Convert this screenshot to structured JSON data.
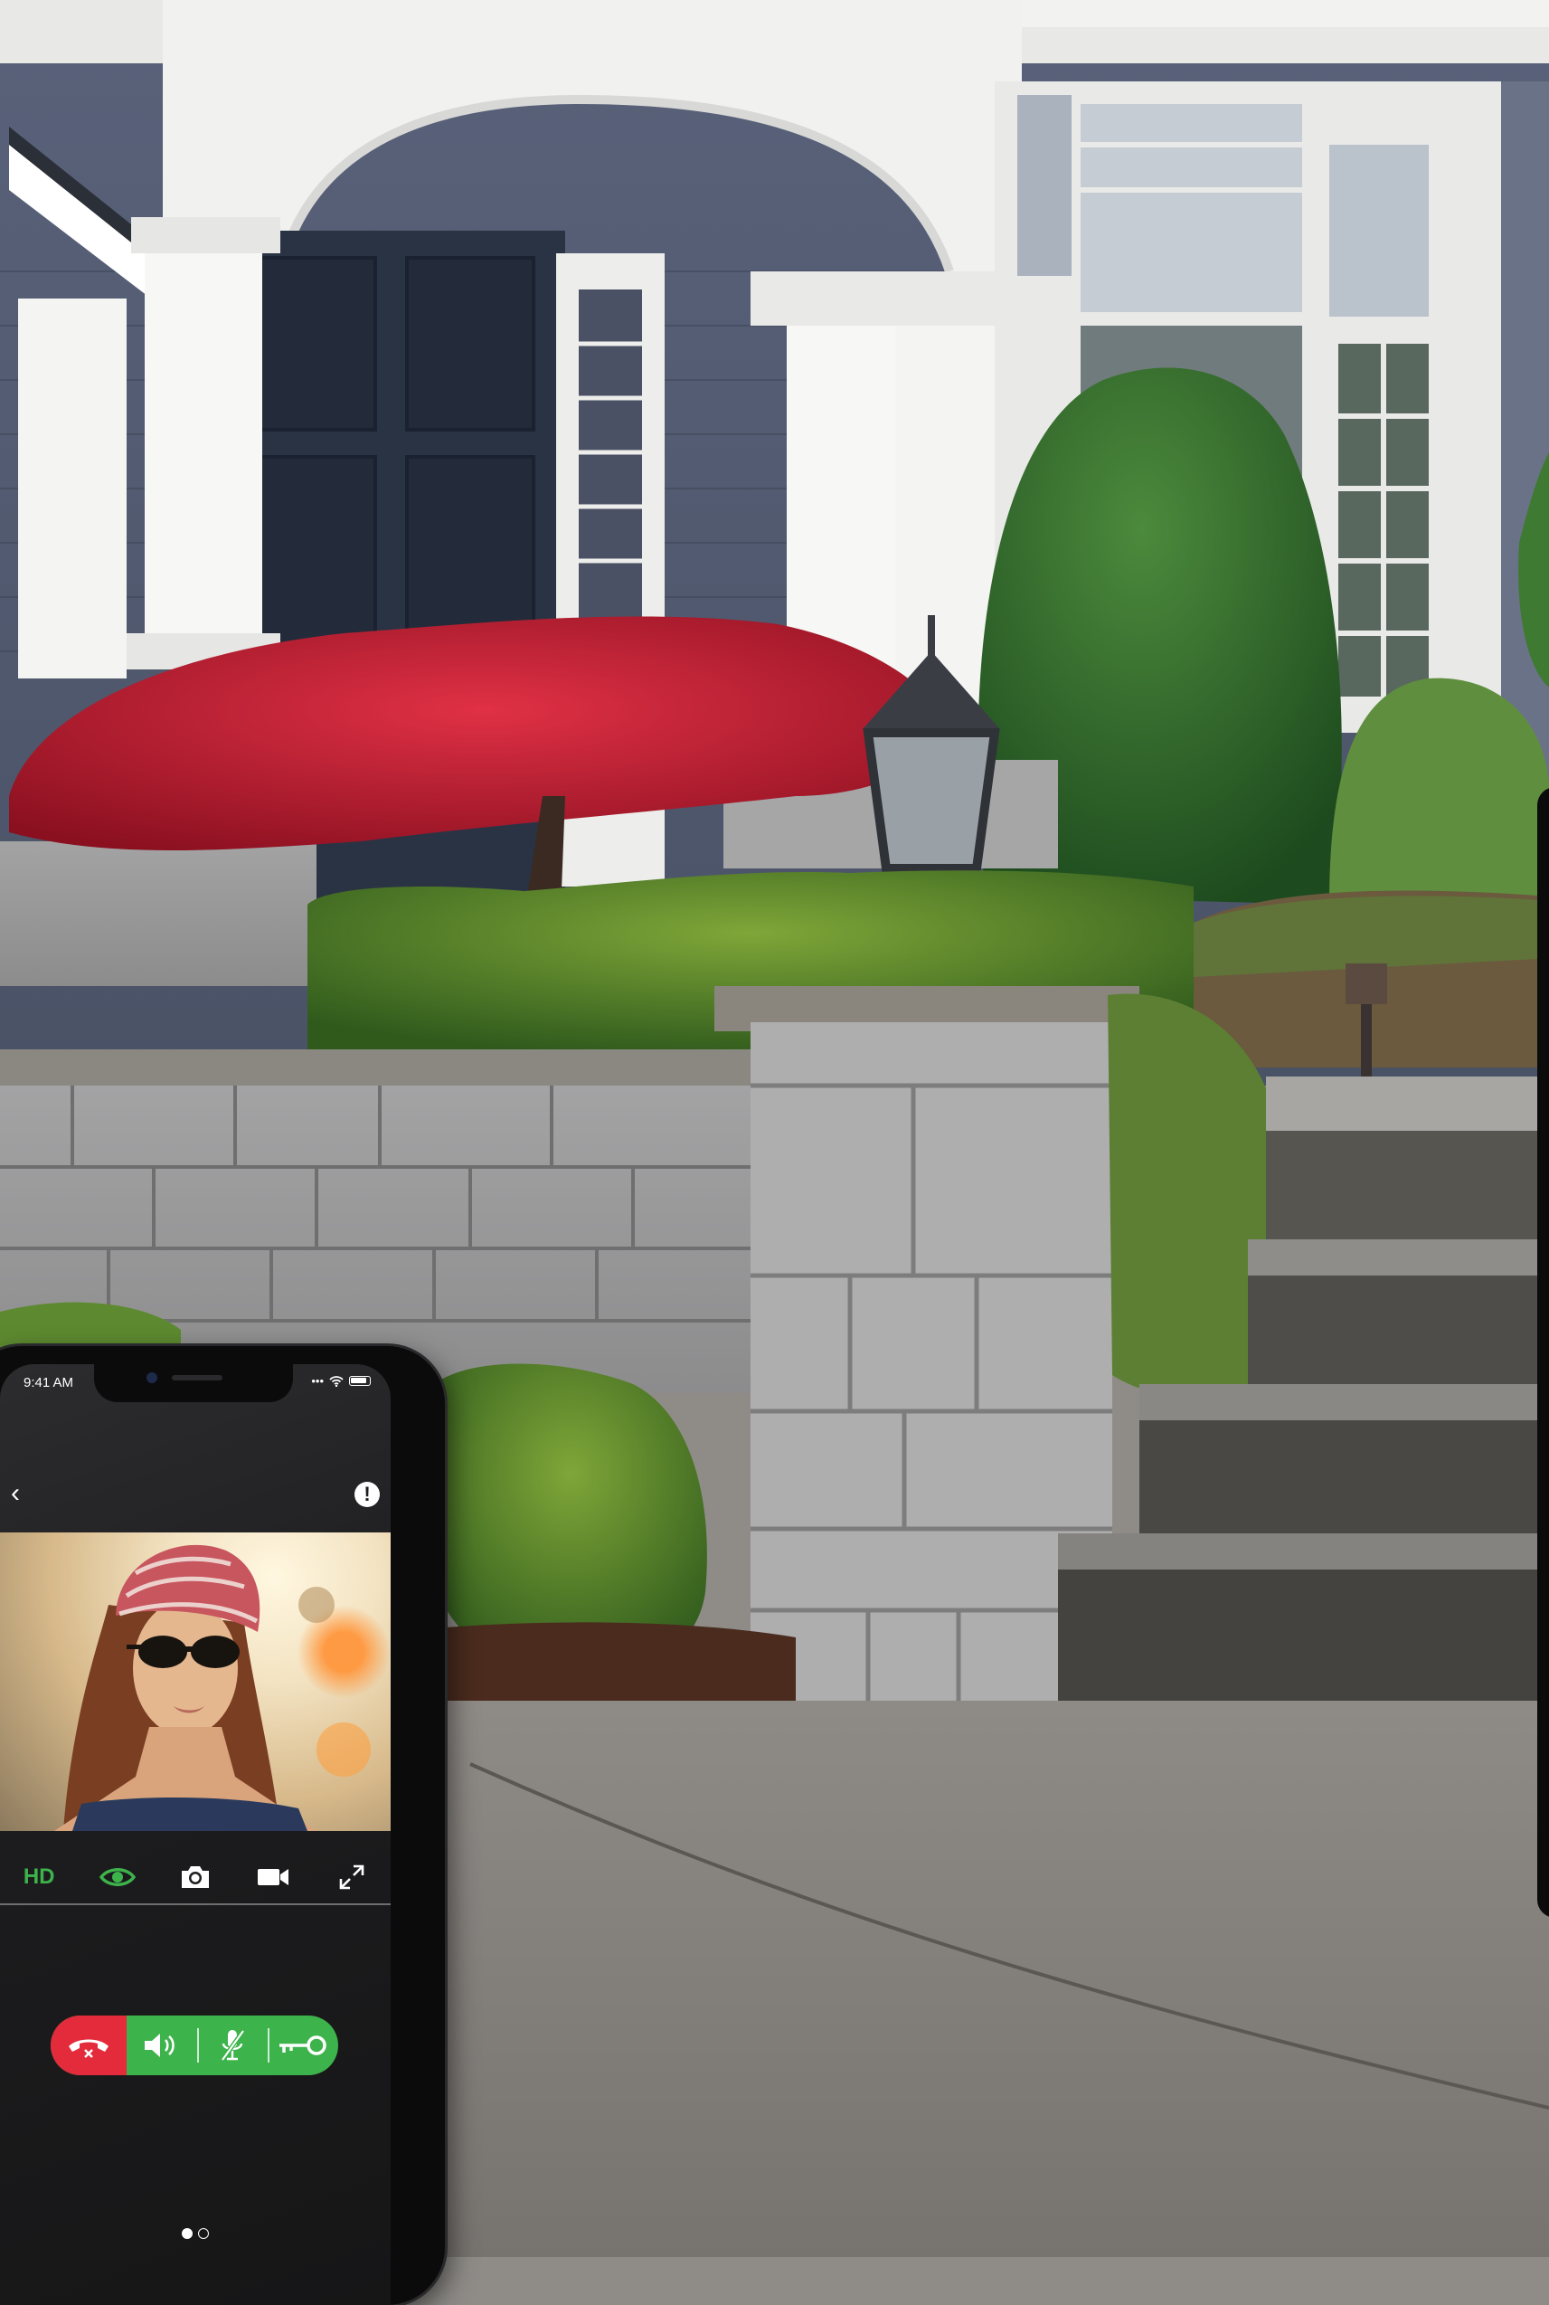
{
  "colors": {
    "accent_green": "#3db34b",
    "hangup_red": "#e32b3b",
    "phone_bg": "#1c1c1e",
    "text_white": "#ffffff"
  },
  "status_bar": {
    "time": "9:41 AM",
    "signal": "•••",
    "wifi_icon": "wifi-icon",
    "battery_icon": "battery-icon"
  },
  "nav": {
    "back_icon": "chevron-left-icon",
    "back_glyph": "‹",
    "info_icon": "exclamation-circle-icon",
    "info_glyph": "!"
  },
  "video": {
    "content": "doorbell-camera-feed"
  },
  "controls": [
    {
      "id": "hd",
      "label": "HD",
      "icon": "hd-text"
    },
    {
      "id": "view",
      "icon": "eye-icon"
    },
    {
      "id": "snapshot",
      "icon": "camera-icon"
    },
    {
      "id": "record",
      "icon": "video-camera-icon"
    },
    {
      "id": "fullscreen",
      "icon": "expand-icon"
    }
  ],
  "call_actions": [
    {
      "id": "hangup",
      "icon": "phone-hangup-icon"
    },
    {
      "id": "speaker",
      "icon": "speaker-icon"
    },
    {
      "id": "mute",
      "icon": "microphone-off-icon"
    },
    {
      "id": "unlock",
      "icon": "key-icon"
    }
  ],
  "pagination": {
    "total": 2,
    "active": 1
  }
}
